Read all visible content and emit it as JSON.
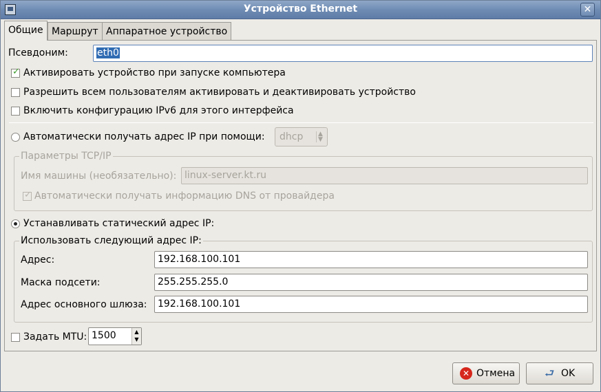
{
  "window": {
    "title": "Устройство Ethernet"
  },
  "tabs": [
    {
      "label": "Общие",
      "active": true
    },
    {
      "label": "Маршрут",
      "active": false
    },
    {
      "label": "Аппаратное устройство",
      "active": false
    }
  ],
  "general": {
    "alias_label": "Псевдоним:",
    "alias_value": "eth0",
    "activate_on_boot": {
      "label": "Активировать устройство при запуске компьютера",
      "checked": true
    },
    "allow_users": {
      "label": "Разрешить всем пользователям активировать и деактивировать устройство",
      "checked": false
    },
    "enable_ipv6": {
      "label": "Включить конфигурацию IPv6 для этого интерфейса",
      "checked": false
    },
    "auto_ip": {
      "label": "Автоматически получать адрес IP при помощи:",
      "selected": false,
      "method": "dhcp"
    },
    "tcpip": {
      "title": "Параметры TCP/IP",
      "hostname_label": "Имя машины (необязательно):",
      "hostname_value": "linux-server.kt.ru",
      "auto_dns_label": "Автоматически получать информацию DNS от провайдера",
      "auto_dns_checked": true
    },
    "static_ip": {
      "label": "Устанавливать статический адрес IP:",
      "selected": true
    },
    "static_frame": {
      "title": "Использовать следующий адрес IP:",
      "address_label": "Адрес:",
      "address_value": "192.168.100.101",
      "netmask_label": "Маска подсети:",
      "netmask_value": "255.255.255.0",
      "gateway_label": "Адрес основного шлюза:",
      "gateway_value": "192.168.100.101"
    },
    "mtu": {
      "label": "Задать MTU:",
      "checked": false,
      "value": "1500"
    }
  },
  "buttons": {
    "cancel": "Отмена",
    "ok": "OK"
  }
}
